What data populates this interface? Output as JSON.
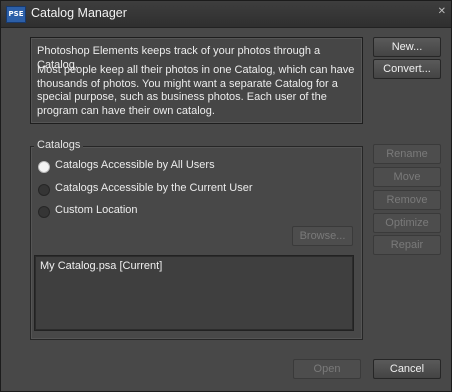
{
  "window": {
    "title": "Catalog Manager",
    "app_icon": "PSE"
  },
  "info": {
    "line1": "Photoshop Elements keeps track of your photos through a Catalog.",
    "line2": "Most people keep all their photos in one Catalog, which can have thousands of photos. You might want a separate Catalog for a special purpose, such as business photos. Each user of the program can have their own catalog."
  },
  "buttons": {
    "new": "New...",
    "convert": "Convert...",
    "rename": "Rename",
    "move": "Move",
    "remove": "Remove",
    "optimize": "Optimize",
    "repair": "Repair",
    "browse": "Browse...",
    "open": "Open",
    "cancel": "Cancel"
  },
  "catalogs": {
    "label": "Catalogs",
    "options": [
      {
        "label": "Catalogs Accessible by All Users",
        "selected": true
      },
      {
        "label": "Catalogs Accessible by the Current User",
        "selected": false
      },
      {
        "label": "Custom Location",
        "selected": false
      }
    ],
    "list": [
      "My Catalog.psa [Current]"
    ]
  }
}
